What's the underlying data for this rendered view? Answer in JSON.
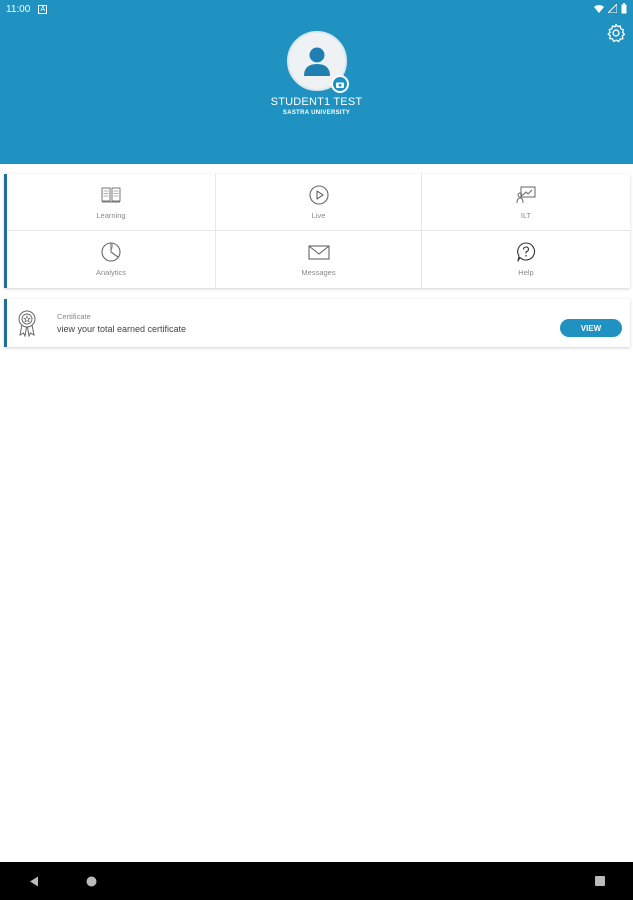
{
  "status_bar": {
    "time": "11:00",
    "notification_glyph": "A"
  },
  "profile": {
    "name": "STUDENT1 TEST",
    "organization": "SASTRA UNIVERSITY"
  },
  "menu": {
    "items": [
      {
        "label": "Learning",
        "icon": "book-icon"
      },
      {
        "label": "Live",
        "icon": "play-circle-icon"
      },
      {
        "label": "ILT",
        "icon": "presentation-icon"
      },
      {
        "label": "Analytics",
        "icon": "pie-chart-icon"
      },
      {
        "label": "Messages",
        "icon": "envelope-icon"
      },
      {
        "label": "Help",
        "icon": "question-bubble-icon"
      }
    ]
  },
  "certificate": {
    "title": "Certificate",
    "subtitle": "view your total earned certificate",
    "button_label": "VIEW"
  },
  "colors": {
    "header": "#1f92c2",
    "accent_border": "#1f6f97",
    "nav_bar": "#000000"
  }
}
